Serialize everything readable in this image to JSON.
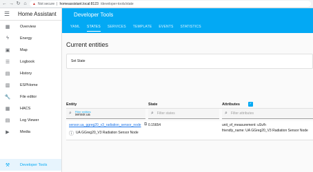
{
  "browser": {
    "back_icon": "arrow-left-icon",
    "forward_icon": "arrow-right-icon",
    "reload_icon": "reload-icon",
    "home_icon": "home-icon",
    "security_label": "Not secure",
    "address_host": "homeassistant.local:8123",
    "address_path": "/developer-tools/state"
  },
  "sidebar": {
    "title": "Home Assistant",
    "items": [
      {
        "label": "Overview",
        "icon": "dashboard-icon"
      },
      {
        "label": "Energy",
        "icon": "lightning-icon"
      },
      {
        "label": "Map",
        "icon": "map-icon"
      },
      {
        "label": "Logbook",
        "icon": "list-icon"
      },
      {
        "label": "History",
        "icon": "chart-icon"
      },
      {
        "label": "ESPHome",
        "icon": "chip-icon"
      },
      {
        "label": "File editor",
        "icon": "wrench-icon"
      },
      {
        "label": "HACS",
        "icon": "store-icon"
      },
      {
        "label": "Log Viewer",
        "icon": "document-icon"
      },
      {
        "label": "Media",
        "icon": "media-icon"
      }
    ],
    "active_item": {
      "label": "Developer Tools",
      "icon": "hammer-icon"
    }
  },
  "header": {
    "title": "Developer Tools",
    "tabs": [
      "YAML",
      "STATES",
      "SERVICES",
      "TEMPLATE",
      "EVENTS",
      "STATISTICS"
    ],
    "active_tab": "STATES"
  },
  "main": {
    "section_title": "Current entities",
    "set_state_label": "Set State",
    "columns": {
      "entity": "Entity",
      "state": "State",
      "attributes": "Attributes"
    },
    "filters": {
      "entities_label": "Filter entities",
      "entities_value": "sensor.ua",
      "states_placeholder": "Filter states",
      "attributes_placeholder": "Filter attributes"
    },
    "rows": [
      {
        "entity_id": "sensor.ua_ggreg20_v3_radiation_sensor_node",
        "friendly_name": "UA GGreg20_V3 Radiation Sensor Node",
        "state": "0.15654",
        "attributes": [
          "unit_of_measurement: uSv/h",
          "friendly_name: UA GGreg20_V3 Radiation Sensor Node"
        ]
      }
    ]
  },
  "colors": {
    "accent": "#03a9f4",
    "link": "#1a73e8"
  }
}
